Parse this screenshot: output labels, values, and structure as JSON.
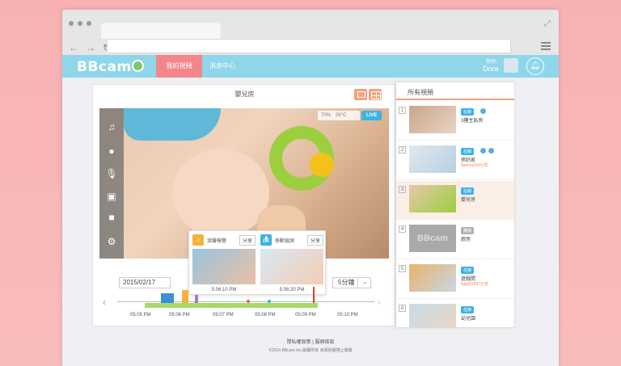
{
  "app": {
    "logo": "BBcam",
    "nav_active": "我的視頻",
    "nav_messages": "消息中心",
    "user_greeting": "你好!",
    "user_name": "Dora"
  },
  "player": {
    "room": "嬰兒房",
    "stats": {
      "humidity": "70%",
      "temperature": "26°C"
    },
    "live": "LIVE",
    "tools": [
      "music-icon",
      "light-icon",
      "microphone-icon",
      "camera-icon",
      "video-camera-icon",
      "settings-icon"
    ],
    "popup": [
      {
        "label": "哭聲報警",
        "share": "分享",
        "time": "5:06:10 PM",
        "color": "#f6b23c"
      },
      {
        "label": "移動偵測",
        "share": "分享",
        "time": "5:06:20 PM",
        "color": "#3ab3e6"
      }
    ],
    "date": "2015/02/17",
    "interval": "5分鐘",
    "ticks": [
      "05:05 PM",
      "05:06 PM",
      "05:07 PM",
      "05:08 PM",
      "05:09 PM",
      "05:10 PM"
    ]
  },
  "list": {
    "title": "所有視頻",
    "items": [
      {
        "num": "1",
        "badge": "在線",
        "badge_color": "#3ab3e6",
        "name": "3樓主臥房",
        "sub": ""
      },
      {
        "num": "2",
        "badge": "在線",
        "badge_color": "#3ab3e6",
        "name": "張奶家",
        "sub": "Ilpoma230分享"
      },
      {
        "num": "3",
        "badge": "在線",
        "badge_color": "#3ab3e6",
        "name": "嬰兒房",
        "sub": ""
      },
      {
        "num": "4",
        "badge": "離線",
        "badge_color": "#b0b0b0",
        "name": "廚房",
        "sub": ""
      },
      {
        "num": "5",
        "badge": "在線",
        "badge_color": "#3ab3e6",
        "name": "遊戲間",
        "sub": "llgigi23087分享"
      },
      {
        "num": "6",
        "badge": "在線",
        "badge_color": "#3ab3e6",
        "name": "幼兒園",
        "sub": ""
      }
    ]
  },
  "footer": {
    "privacy": "隱私權政策",
    "separator": "|",
    "terms": "服務條款",
    "copyright": "©2014 BBcam Inc.版權所有 未經授權禁止複製"
  }
}
